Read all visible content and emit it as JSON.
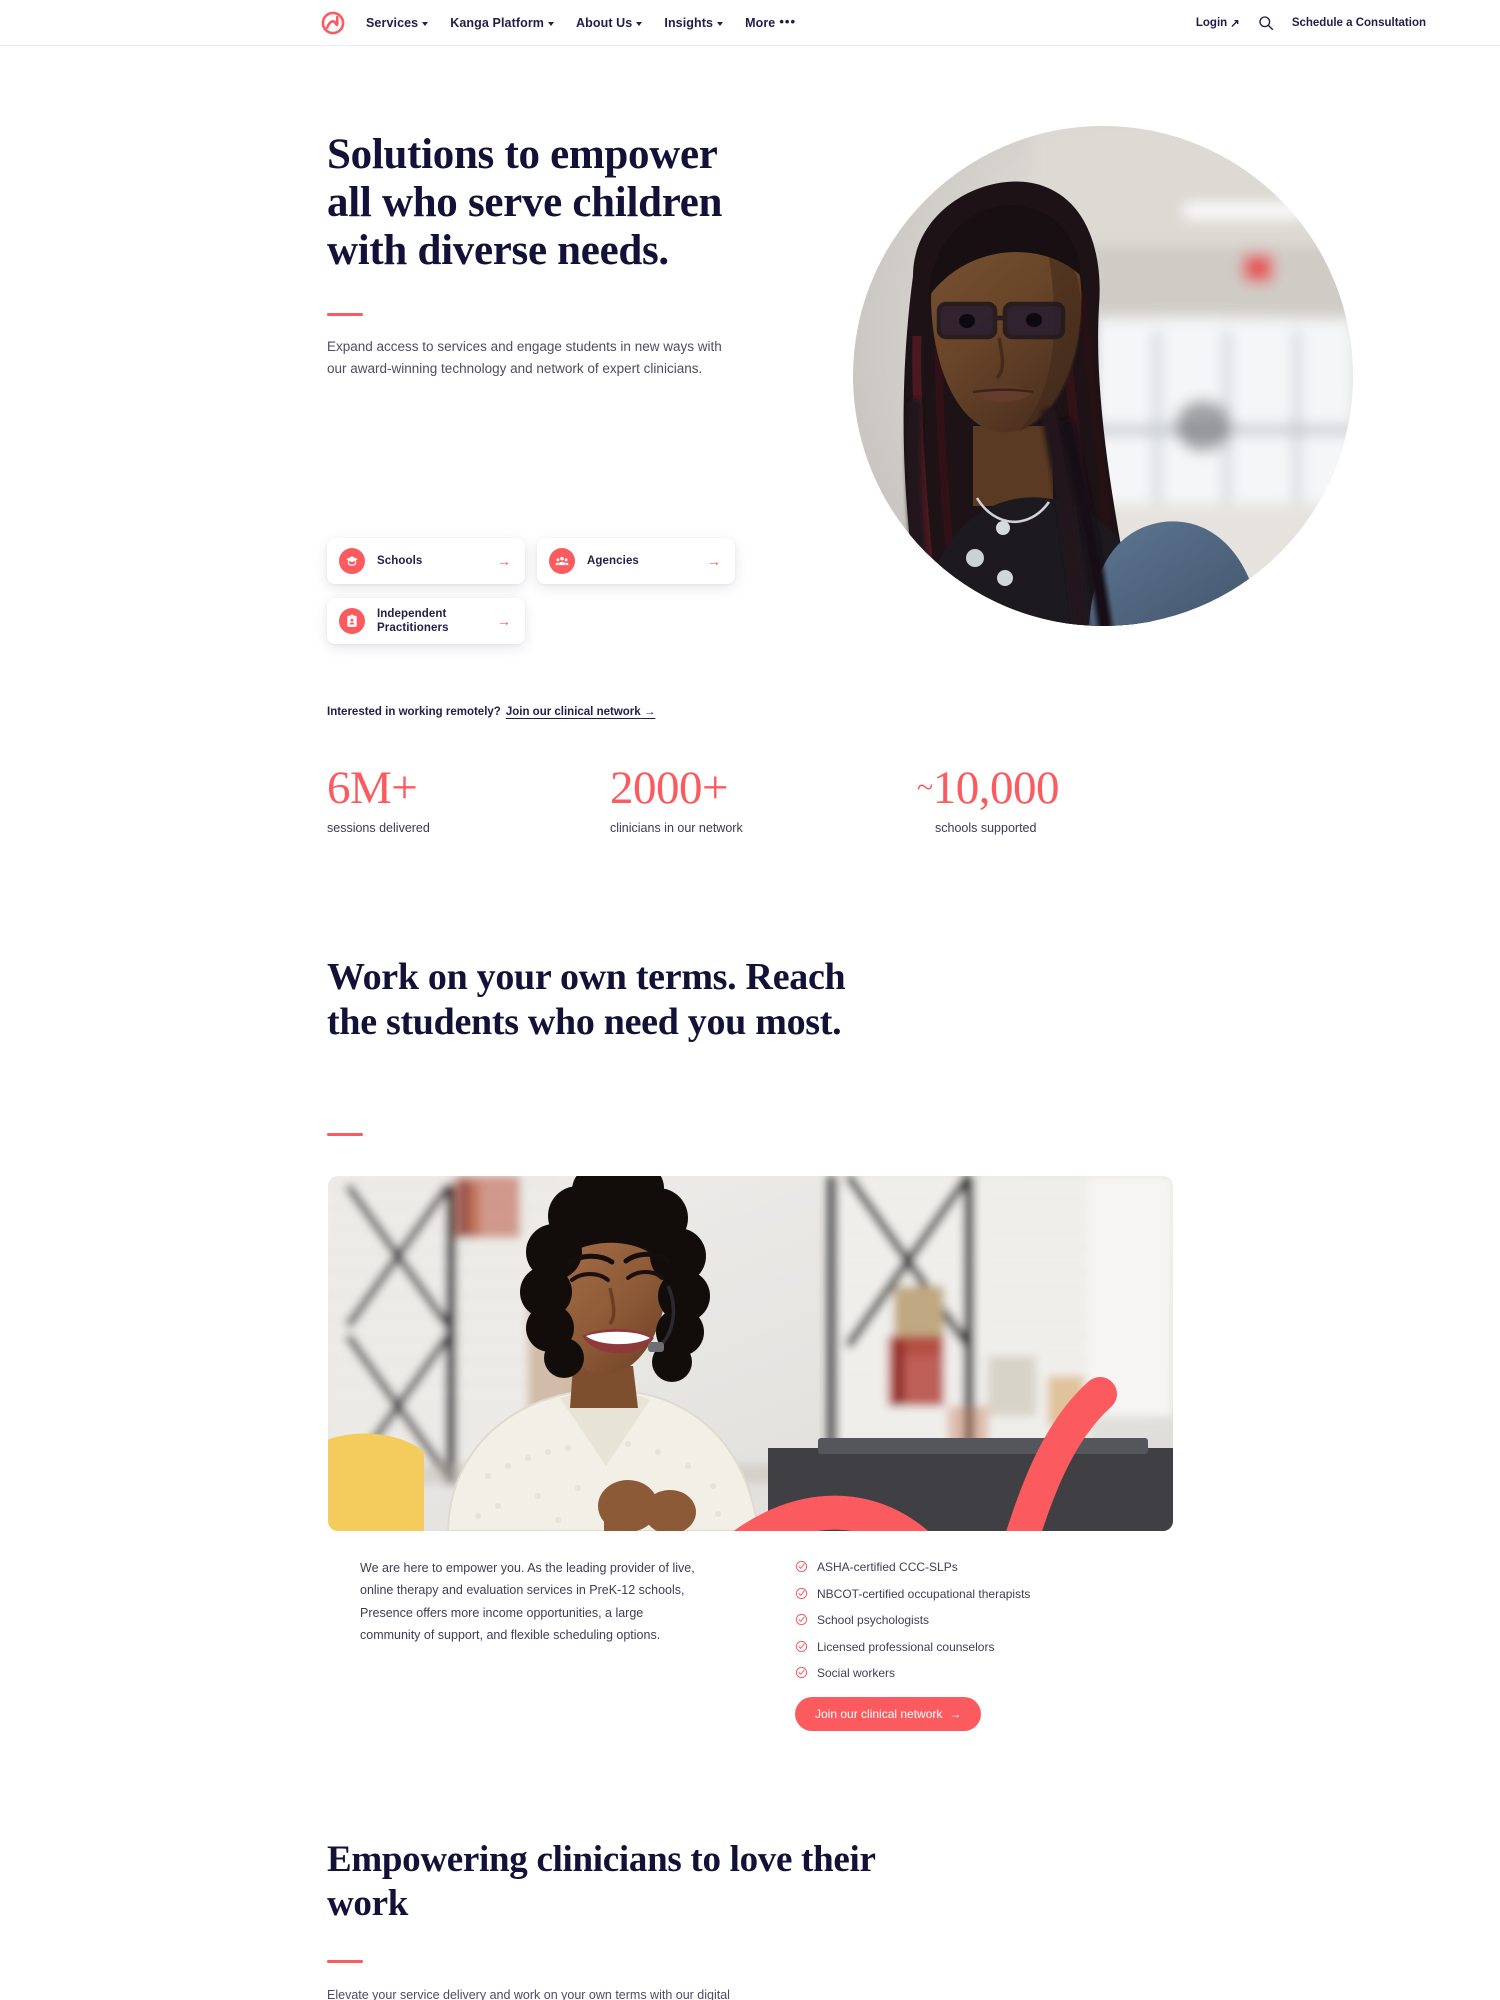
{
  "brand": {
    "accent_color": "#fb5b5f",
    "ink_color": "#141139",
    "logo_name": "presence-logo"
  },
  "nav": {
    "links": [
      {
        "label": "Services",
        "has_caret": true
      },
      {
        "label": "Kanga Platform",
        "has_caret": true
      },
      {
        "label": "About Us",
        "has_caret": true
      },
      {
        "label": "Insights",
        "has_caret": true
      },
      {
        "label": "More",
        "has_caret": false,
        "dots": "•••"
      }
    ],
    "login_label": "Login",
    "login_arrow": "↗",
    "search_icon": "search-icon",
    "cta_label": "Schedule a Consultation"
  },
  "hero": {
    "title": "Solutions to empower all who serve children with diverse needs.",
    "subtitle": "Expand access to services and engage students in new ways with our award-winning technology and network of expert clinicians.",
    "cards": [
      {
        "label": "Schools",
        "icon": "graduation-cap-icon",
        "arrow": "→"
      },
      {
        "label": "Agencies",
        "icon": "people-group-icon",
        "arrow": "→"
      },
      {
        "label": "Independent Practitioners",
        "icon": "id-badge-icon",
        "arrow": "→"
      }
    ],
    "remote_prompt": "Interested in working remotely?",
    "remote_link": "Join our clinical network",
    "remote_arrow": "→",
    "photo_alt": "student-portrait-photo"
  },
  "stats": [
    {
      "value": "6M+",
      "label": "sessions delivered"
    },
    {
      "value": "2000+",
      "label": "clinicians in our network"
    },
    {
      "value": "10,000",
      "prefix": "~",
      "label": "schools supported"
    }
  ],
  "section2": {
    "title": "Work on your own terms. Reach the students who need you most.",
    "photo_alt": "clinician-video-session-photo",
    "body": "We are here to empower you. As the leading provider of live, online therapy and evaluation services in PreK-12 schools, Presence offers more income opportunities, a large community of support, and flexible scheduling options.",
    "checklist": [
      "ASHA-certified CCC-SLPs",
      "NBCOT-certified occupational therapists",
      "School psychologists",
      "Licensed professional counselors",
      "Social workers"
    ],
    "cta_label": "Join our clinical network",
    "cta_arrow": "→"
  },
  "section3": {
    "title": "Empowering clinicians to love their work",
    "body": "Elevate your service delivery and work on your own terms with our digital"
  }
}
